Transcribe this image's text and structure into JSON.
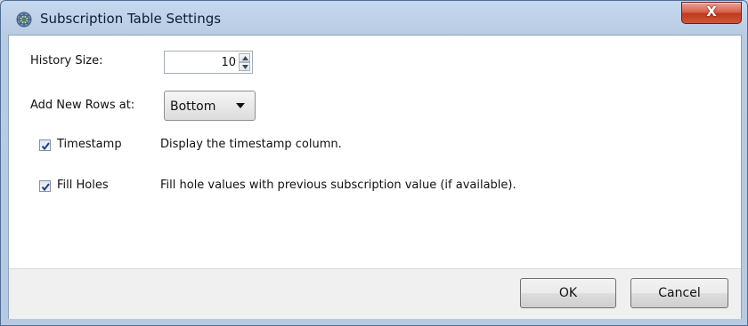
{
  "window": {
    "title": "Subscription Table Settings",
    "close_glyph": "X",
    "app_icon": "gear-globe-icon"
  },
  "history_size": {
    "label": "History Size:",
    "value": "10"
  },
  "add_rows": {
    "label": "Add New Rows at:",
    "selected": "Bottom"
  },
  "options": [
    {
      "label": "Timestamp",
      "checked": true,
      "description": "Display the timestamp column."
    },
    {
      "label": "Fill Holes",
      "checked": true,
      "description": "Fill hole values with previous subscription value (if available)."
    }
  ],
  "buttons": {
    "ok": "OK",
    "cancel": "Cancel"
  },
  "colors": {
    "titlebar": "#c6d8ee",
    "close_button": "#c9432a",
    "footer": "#f0f0f0"
  }
}
